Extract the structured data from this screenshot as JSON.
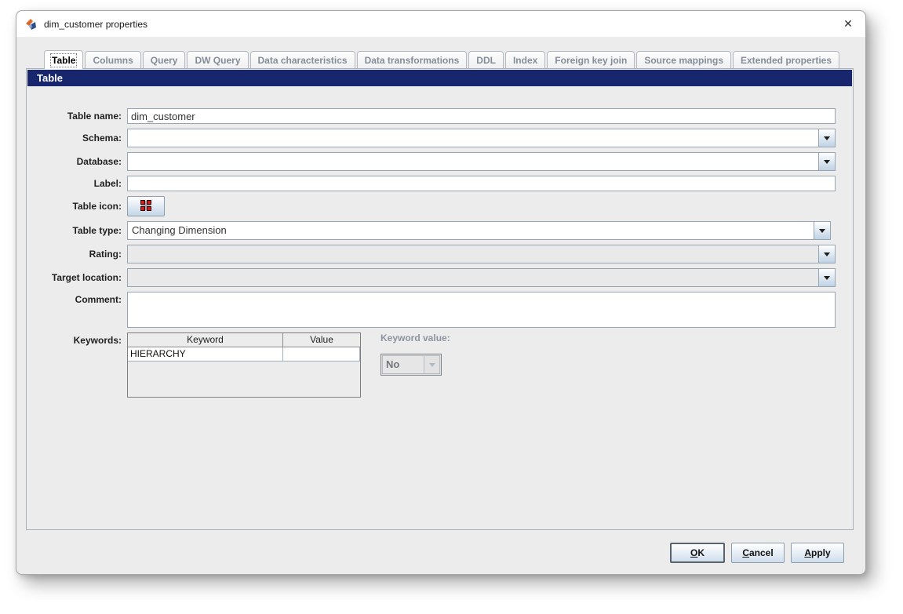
{
  "window": {
    "title": "dim_customer properties",
    "close_glyph": "✕"
  },
  "tabs": [
    {
      "label": "Table",
      "selected": true
    },
    {
      "label": "Columns",
      "selected": false
    },
    {
      "label": "Query",
      "selected": false
    },
    {
      "label": "DW Query",
      "selected": false
    },
    {
      "label": "Data characteristics",
      "selected": false
    },
    {
      "label": "Data transformations",
      "selected": false
    },
    {
      "label": "DDL",
      "selected": false
    },
    {
      "label": "Index",
      "selected": false
    },
    {
      "label": "Foreign key join",
      "selected": false
    },
    {
      "label": "Source mappings",
      "selected": false
    },
    {
      "label": "Extended properties",
      "selected": false
    }
  ],
  "section": {
    "title": "Table"
  },
  "form": {
    "table_name": {
      "label": "Table name:",
      "value": "dim_customer"
    },
    "schema": {
      "label": "Schema:",
      "value": ""
    },
    "database": {
      "label": "Database:",
      "value": ""
    },
    "label_field": {
      "label": "Label:",
      "value": ""
    },
    "table_icon": {
      "label": "Table icon:"
    },
    "table_type": {
      "label": "Table type:",
      "value": "Changing Dimension"
    },
    "rating": {
      "label": "Rating:",
      "value": ""
    },
    "target_location": {
      "label": "Target location:",
      "value": ""
    },
    "comment": {
      "label": "Comment:",
      "value": ""
    },
    "keywords": {
      "label": "Keywords:",
      "columns": [
        "Keyword",
        "Value"
      ],
      "rows": [
        [
          "HIERARCHY",
          ""
        ]
      ]
    },
    "keyword_value": {
      "label": "Keyword value:",
      "value": "No"
    }
  },
  "buttons": {
    "ok": "OK",
    "cancel": "Cancel",
    "apply": "Apply"
  },
  "colors": {
    "section_header_bg": "#18276d",
    "section_header_text": "#ffffff",
    "table_icon_red": "#cc1f1f",
    "field_border": "#97a4b3",
    "disabled_text": "#8c949e"
  }
}
